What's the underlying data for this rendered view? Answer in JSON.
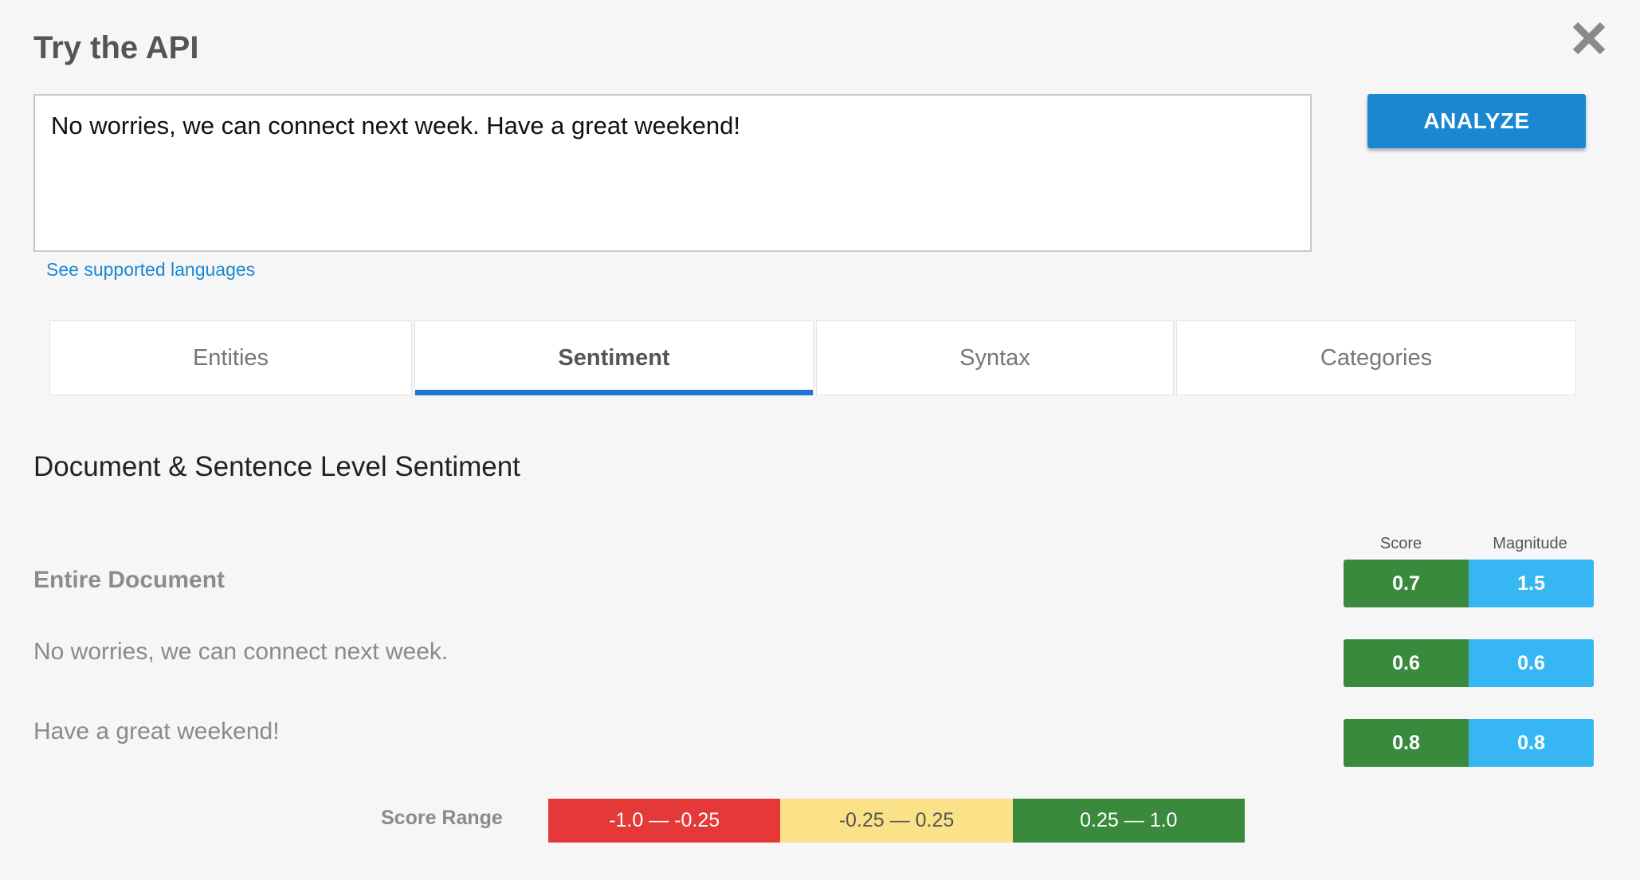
{
  "header": {
    "title": "Try the API",
    "close_icon": "close-icon"
  },
  "input": {
    "value": "No worries, we can connect next week. Have a great weekend!",
    "placeholder": ""
  },
  "actions": {
    "analyze_label": "ANALYZE",
    "languages_link": "See supported languages"
  },
  "tabs": [
    {
      "label": "Entities",
      "active": false
    },
    {
      "label": "Sentiment",
      "active": true
    },
    {
      "label": "Syntax",
      "active": false
    },
    {
      "label": "Categories",
      "active": false
    }
  ],
  "sentiment": {
    "section_title": "Document & Sentence Level Sentiment",
    "columns": {
      "score": "Score",
      "magnitude": "Magnitude"
    },
    "document": {
      "label": "Entire Document",
      "score": "0.7",
      "magnitude": "1.5"
    },
    "sentences": [
      {
        "text": "No worries, we can connect next week.",
        "score": "0.6",
        "magnitude": "0.6"
      },
      {
        "text": "Have a great weekend!",
        "score": "0.8",
        "magnitude": "0.8"
      }
    ],
    "score_range": {
      "label": "Score Range",
      "negative": "-1.0 — -0.25",
      "neutral": "-0.25 — 0.25",
      "positive": "0.25 — 1.0"
    }
  },
  "colors": {
    "accent": "#1a87d3",
    "tab_indicator": "#1e74d3",
    "score_green": "#3a8a3e",
    "magnitude_blue": "#36b7f3",
    "range_red": "#e53939",
    "range_yellow": "#fbe289"
  }
}
